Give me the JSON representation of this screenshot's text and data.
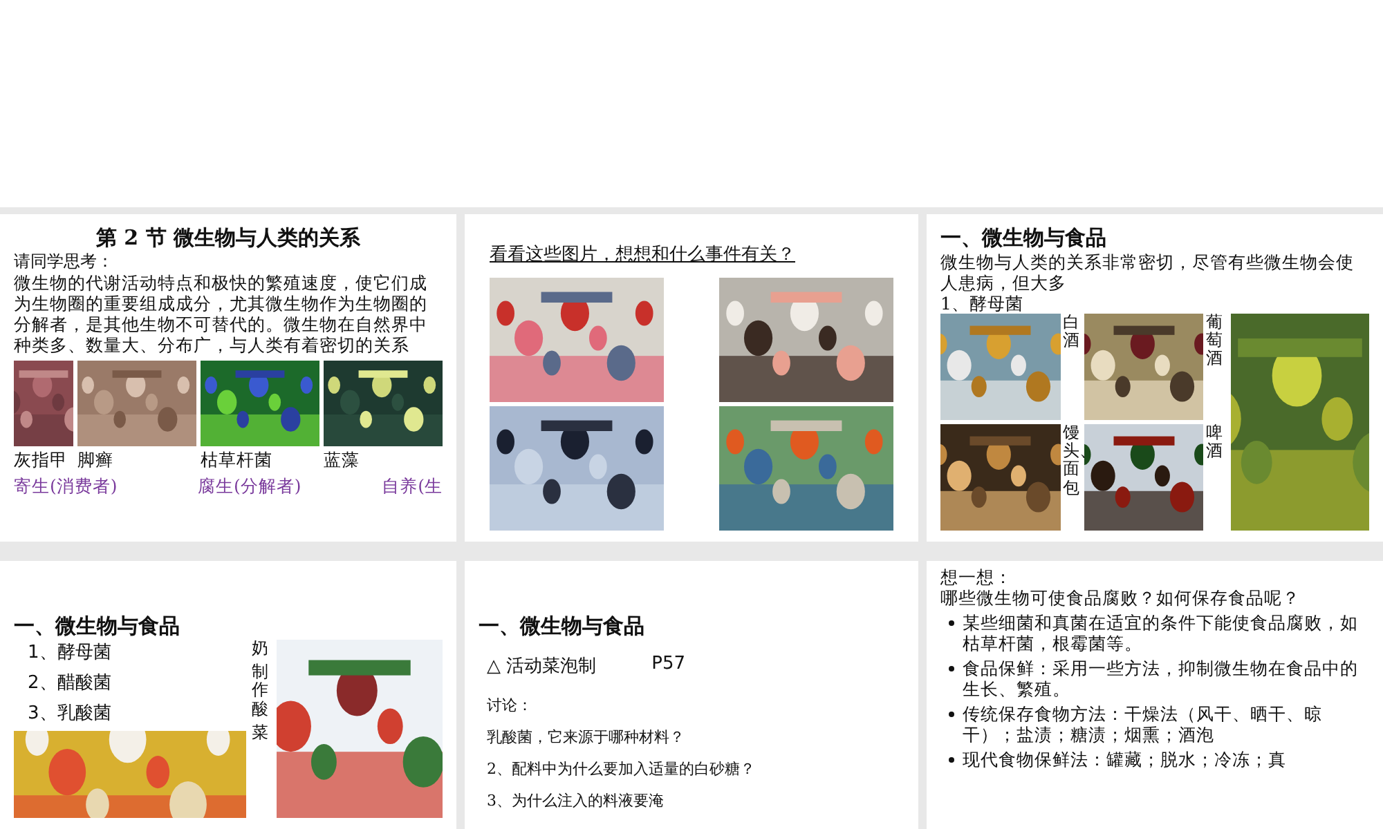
{
  "slides": [
    {
      "kind": "title",
      "title": "第 2 节 微生物与人类的关系",
      "prompt": "请同学思考：",
      "body": "微生物的代谢活动特点和极快的繁殖速度，使它们成为生物圈的重要组成成分，尤其微生物作为生物圈的分解者，是其他生物不可替代的。微生物在自然界中种类多、数量大、分布广，与人类有着密切的关系",
      "photos": [
        {
          "kind": "picture"
        },
        {
          "kind": "picture"
        },
        {
          "kind": "picture"
        },
        {
          "kind": "picture"
        }
      ],
      "captions": [
        "灰指甲",
        "脚癣",
        "枯草杆菌",
        "蓝藻"
      ],
      "roles": [
        "寄生(消费者)",
        "腐生(分解者)",
        "自养(生"
      ]
    },
    {
      "kind": "photos",
      "title": "看看这些图片，想想和什么事件有关？",
      "photos": [
        {
          "kind": "picture"
        },
        {
          "kind": "picture"
        },
        {
          "kind": "picture"
        },
        {
          "kind": "picture"
        }
      ]
    },
    {
      "kind": "collage",
      "title": "一、微生物与食品",
      "body": "微生物与人类的关系非常密切，尽管有些微生物会使人患病，但大多",
      "subtitle": "1、酵母菌",
      "photos": [
        {
          "kind": "picture"
        },
        {
          "kind": "picture"
        },
        {
          "kind": "picture"
        },
        {
          "kind": "picture"
        },
        {
          "kind": "picture"
        }
      ],
      "captions": [
        "白酒",
        "葡萄酒",
        "馒头、面包",
        "啤酒"
      ]
    },
    {
      "kind": "list",
      "title": "一、微生物与食品",
      "items": [
        "1、酵母菌",
        "2、醋酸菌",
        "3、乳酸菌"
      ],
      "photos": [
        {
          "kind": "picture"
        },
        {
          "kind": "picture"
        }
      ],
      "captions": [
        "奶",
        "制作酸",
        "菜"
      ]
    },
    {
      "kind": "discussion",
      "title": "一、微生物与食品",
      "activity": "△ 活动菜泡制",
      "page": "P57",
      "label": "讨论：",
      "questions": [
        "乳酸菌，它来源于哪种材料？",
        "2、配料中为什么要加入适量的白砂糖？",
        "3、为什么注入的料液要淹"
      ]
    },
    {
      "kind": "bullets",
      "title": "想一想：",
      "question": "哪些微生物可使食品腐败？如何保存食品呢？",
      "bullets": [
        "某些细菌和真菌在适宜的条件下能使食品腐败，如枯草杆菌，根霉菌等。",
        "食品保鲜：采用一些方法，抑制微生物在食品中的生长、繁殖。",
        "传统保存食物方法：干燥法（风干、晒干、晾干）；盐渍；糖渍；烟熏；酒泡",
        "现代食物保鲜法：罐藏；脱水；冷冻；真"
      ]
    }
  ]
}
